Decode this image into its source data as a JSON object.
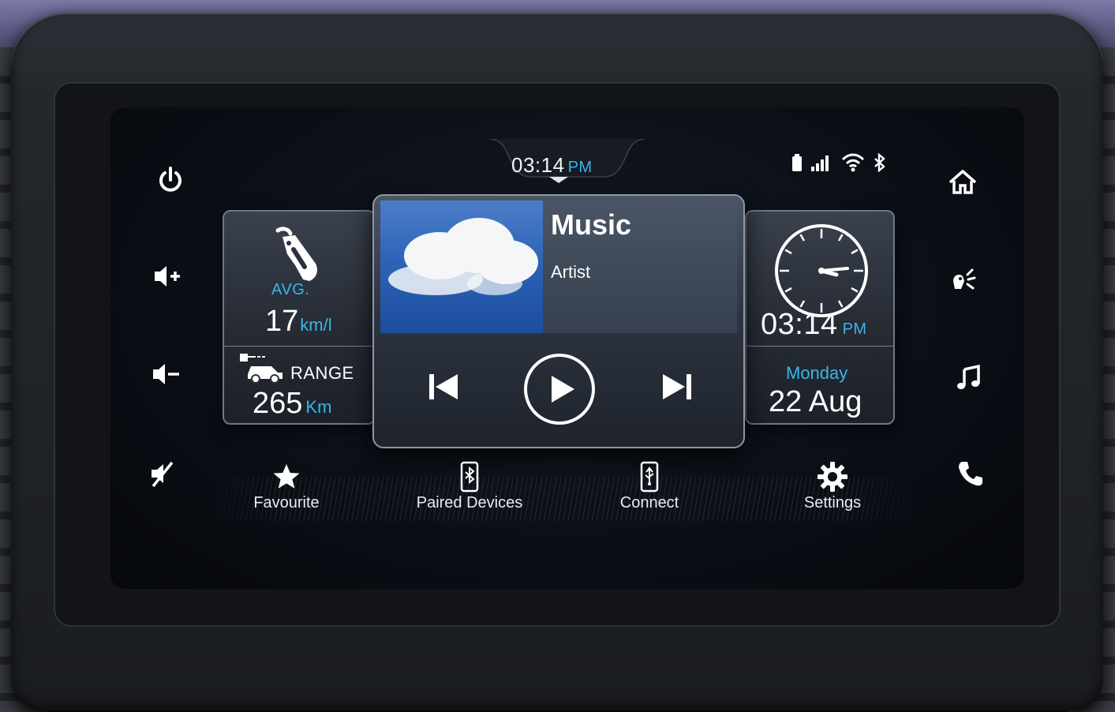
{
  "status_bar": {
    "time": "03:14",
    "ampm": "PM",
    "icons": [
      "battery-icon",
      "signal-icon",
      "wifi-icon",
      "bluetooth-icon"
    ]
  },
  "left_controls": [
    "power-icon",
    "volume-up-icon",
    "volume-down-icon",
    "mute-icon"
  ],
  "right_controls": [
    "home-icon",
    "voice-command-icon",
    "music-note-icon",
    "phone-icon"
  ],
  "fuel_card": {
    "avg_label": "AVG.",
    "avg_value": "17",
    "avg_unit": "km/l",
    "range_label": "RANGE",
    "range_value": "265",
    "range_unit": "Km"
  },
  "music_card": {
    "title": "Music",
    "artist": "Artist",
    "controls": [
      "previous-track-icon",
      "play-icon",
      "next-track-icon"
    ]
  },
  "clock_card": {
    "time": "03:14",
    "ampm": "PM",
    "day": "Monday",
    "date": "22 Aug"
  },
  "bottom_nav": [
    {
      "label": "Favourite",
      "icon": "star-icon"
    },
    {
      "label": "Paired Devices",
      "icon": "bluetooth-phone-icon"
    },
    {
      "label": "Connect",
      "icon": "usb-phone-icon"
    },
    {
      "label": "Settings",
      "icon": "gear-icon"
    }
  ],
  "colors": {
    "accent": "#39b6e8",
    "text": "#ffffff",
    "screen_bg": "#0b0f16"
  }
}
